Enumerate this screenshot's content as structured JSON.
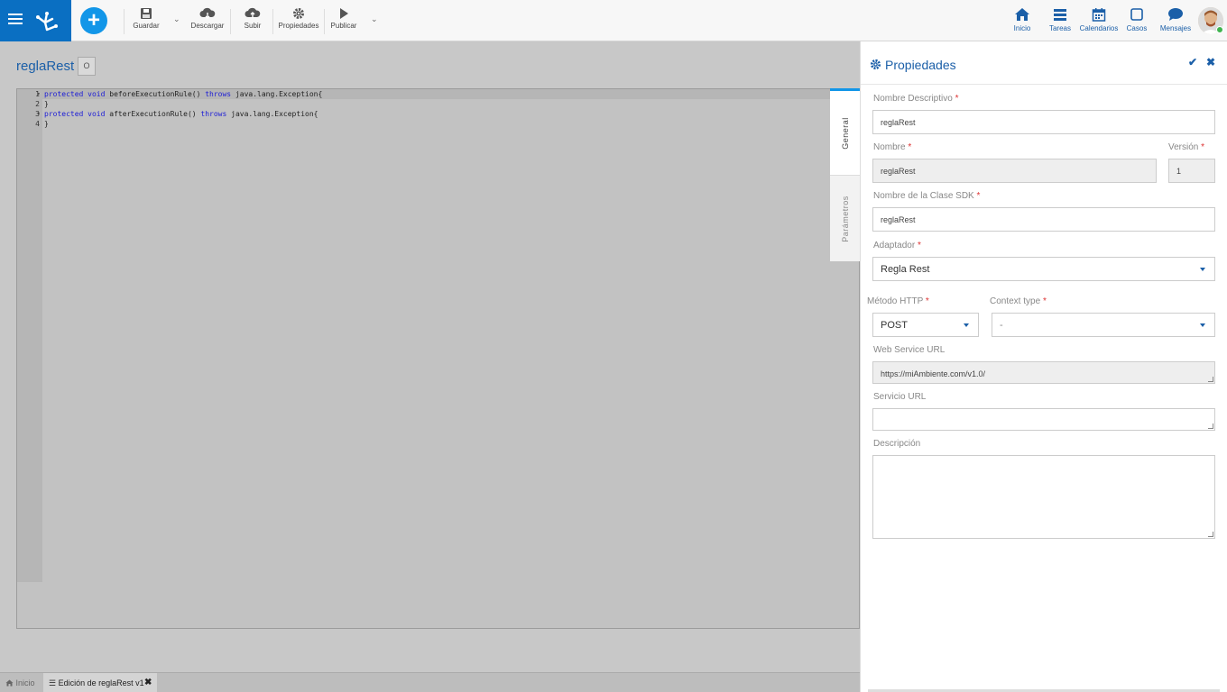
{
  "toolbar": {
    "save": "Guardar",
    "download": "Descargar",
    "upload": "Subir",
    "properties": "Propiedades",
    "publish": "Publicar"
  },
  "nav": {
    "home": "Inicio",
    "tasks": "Tareas",
    "calendars": "Calendarios",
    "cases": "Casos",
    "messages": "Mensajes"
  },
  "editor": {
    "title": "reglaRest",
    "badge": "O",
    "lines": [
      {
        "num": "1",
        "fold": "▾",
        "kw": "protected void",
        "rest": " beforeExecutionRule() ",
        "kw2": "throws",
        "rest2": " java.lang.Exception{"
      },
      {
        "num": "2",
        "fold": "",
        "kw": "",
        "rest": "}",
        "kw2": "",
        "rest2": ""
      },
      {
        "num": "3",
        "fold": "▾",
        "kw": "protected void",
        "rest": " afterExecutionRule() ",
        "kw2": "throws",
        "rest2": " java.lang.Exception{"
      },
      {
        "num": "4",
        "fold": "",
        "kw": "",
        "rest": "}",
        "kw2": "",
        "rest2": ""
      }
    ]
  },
  "side_tabs": {
    "general": "General",
    "parametros": "Parámetros"
  },
  "bottom": {
    "home": "Inicio",
    "tab": "Edición de reglaRest v1"
  },
  "panel": {
    "title": "Propiedades",
    "required_mark": "*",
    "nombre_descriptivo_label": "Nombre Descriptivo",
    "nombre_descriptivo_value": "reglaRest",
    "nombre_label": "Nombre",
    "nombre_value": "reglaRest",
    "version_label": "Versión",
    "version_value": "1",
    "clase_sdk_label": "Nombre de la Clase SDK",
    "clase_sdk_value": "reglaRest",
    "adaptador_label": "Adaptador",
    "adaptador_value": "Regla Rest",
    "metodo_label": "Método HTTP",
    "metodo_value": "POST",
    "context_label": "Context type",
    "context_value": "-",
    "ws_url_label": "Web Service URL",
    "ws_url_value": "https://miAmbiente.com/v1.0/",
    "servicio_url_label": "Servicio URL",
    "servicio_url_value": "",
    "descripcion_label": "Descripción",
    "descripcion_value": ""
  },
  "colors": {
    "brand": "#0a6fc2",
    "accent": "#1296e8",
    "link": "#1b5fa8",
    "required": "#d33333"
  }
}
